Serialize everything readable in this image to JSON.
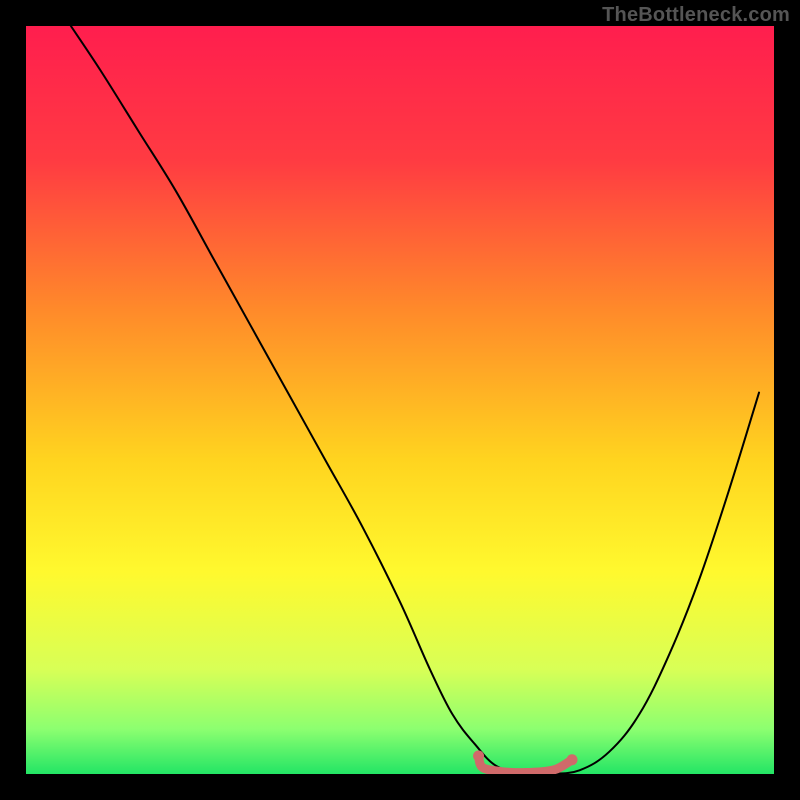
{
  "attribution": "TheBottleneck.com",
  "chart_data": {
    "type": "line",
    "title": "",
    "xlabel": "",
    "ylabel": "",
    "xlim": [
      0,
      100
    ],
    "ylim": [
      0,
      100
    ],
    "background_gradient": {
      "stops": [
        {
          "offset": 0,
          "color": "#ff1e4e"
        },
        {
          "offset": 18,
          "color": "#ff3b42"
        },
        {
          "offset": 38,
          "color": "#ff8a2a"
        },
        {
          "offset": 58,
          "color": "#ffd41f"
        },
        {
          "offset": 73,
          "color": "#fff92e"
        },
        {
          "offset": 86,
          "color": "#d8ff56"
        },
        {
          "offset": 94,
          "color": "#8cff70"
        },
        {
          "offset": 100,
          "color": "#23e565"
        }
      ]
    },
    "series": [
      {
        "name": "curve",
        "color": "#000000",
        "width": 2,
        "x": [
          6,
          10,
          15,
          20,
          25,
          30,
          35,
          40,
          45,
          50,
          54,
          57,
          60,
          63,
          67,
          70,
          74,
          78,
          82,
          86,
          90,
          94,
          98
        ],
        "y": [
          100,
          94,
          86,
          78,
          69,
          60,
          51,
          42,
          33,
          23,
          14,
          8,
          4,
          1,
          0,
          0,
          0.5,
          3,
          8,
          16,
          26,
          38,
          51
        ]
      },
      {
        "name": "highlight",
        "color": "#d06a6a",
        "width": 9,
        "cap": "round",
        "x": [
          60.5,
          61,
          63,
          65,
          67,
          69,
          71,
          73
        ],
        "y": [
          2.4,
          0.9,
          0.4,
          0.2,
          0.2,
          0.3,
          0.7,
          1.9
        ]
      }
    ],
    "dots": [
      {
        "x": 60.5,
        "y": 2.4,
        "r": 5.5,
        "color": "#d06a6a"
      },
      {
        "x": 73,
        "y": 1.9,
        "r": 5.5,
        "color": "#d06a6a"
      }
    ]
  }
}
